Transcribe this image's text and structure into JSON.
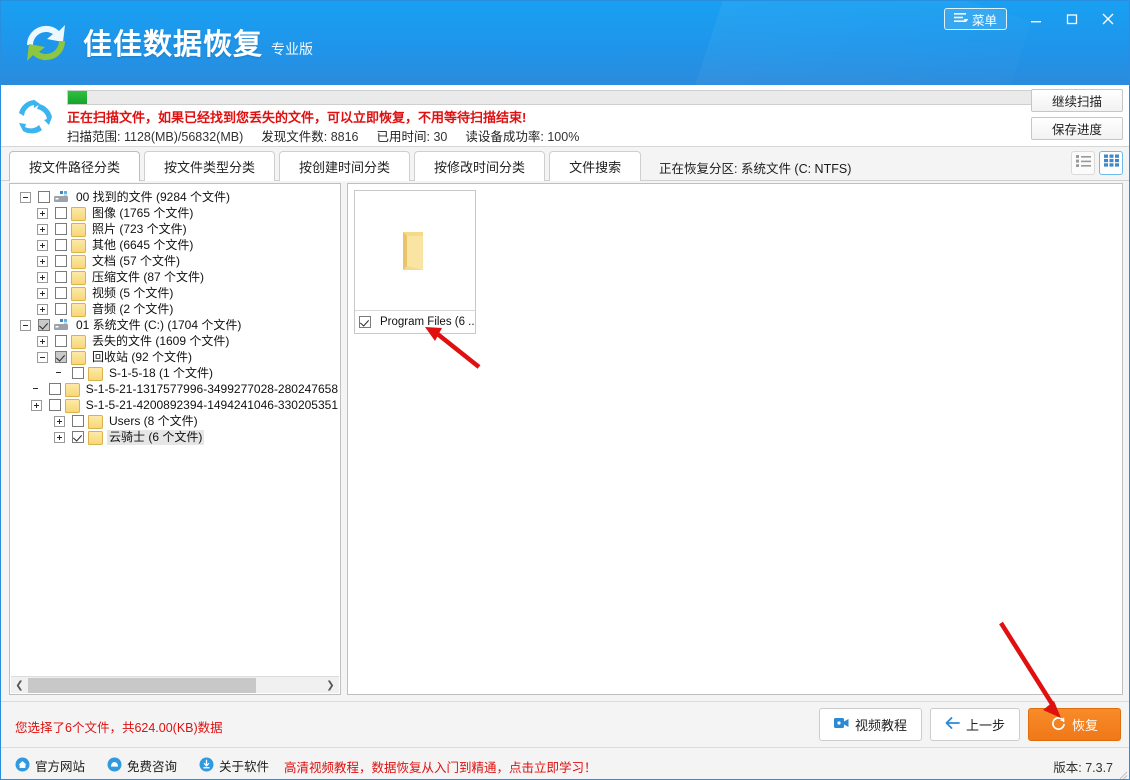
{
  "app": {
    "brand_main": "佳佳数据恢复",
    "brand_sub": "专业版",
    "menu_label": "菜单",
    "logo_icon": "recovery-arrows-logo"
  },
  "window_controls": {
    "minimize": "minimize-icon",
    "maximize": "maximize-icon",
    "close": "close-icon"
  },
  "scan": {
    "icon": "recycle-icon",
    "progress_percent": 2,
    "warning": "正在扫描文件，如果已经找到您丢失的文件，可以立即恢复，不用等待扫描结束!",
    "stats": [
      {
        "key": "扫描范围:",
        "value": "1128(MB)/56832(MB)"
      },
      {
        "key": "发现文件数:",
        "value": "8816"
      },
      {
        "key": "已用时间:",
        "value": "30"
      },
      {
        "key": "读设备成功率:",
        "value": "100%"
      }
    ],
    "buttons": [
      {
        "label": "继续扫描"
      },
      {
        "label": "保存进度"
      }
    ]
  },
  "tabs": {
    "items": [
      {
        "label": "按文件路径分类",
        "active": true
      },
      {
        "label": "按文件类型分类",
        "active": false
      },
      {
        "label": "按创建时间分类",
        "active": false
      },
      {
        "label": "按修改时间分类",
        "active": false
      },
      {
        "label": "文件搜索",
        "active": false
      }
    ],
    "partition_label": "正在恢复分区: 系统文件 (C: NTFS)",
    "view_list_icon": "list-view-icon",
    "view_grid_icon": "grid-view-icon",
    "active_view": "grid"
  },
  "tree": {
    "rows": [
      {
        "indent": 0,
        "expander": "minus",
        "check": "none",
        "icon": "drive",
        "label": "00 找到的文件",
        "count": "(9284 个文件)"
      },
      {
        "indent": 1,
        "expander": "plus",
        "check": "none",
        "icon": "folder",
        "label": "图像",
        "count": "(1765 个文件)"
      },
      {
        "indent": 1,
        "expander": "plus",
        "check": "none",
        "icon": "folder",
        "label": "照片",
        "count": "(723 个文件)"
      },
      {
        "indent": 1,
        "expander": "plus",
        "check": "none",
        "icon": "folder",
        "label": "其他",
        "count": "(6645 个文件)"
      },
      {
        "indent": 1,
        "expander": "plus",
        "check": "none",
        "icon": "folder",
        "label": "文档",
        "count": "(57 个文件)"
      },
      {
        "indent": 1,
        "expander": "plus",
        "check": "none",
        "icon": "folder",
        "label": "压缩文件",
        "count": "(87 个文件)"
      },
      {
        "indent": 1,
        "expander": "plus",
        "check": "none",
        "icon": "folder",
        "label": "视频",
        "count": "(5 个文件)"
      },
      {
        "indent": 1,
        "expander": "plus",
        "check": "none",
        "icon": "folder",
        "label": "音频",
        "count": "(2 个文件)"
      },
      {
        "indent": 0,
        "expander": "minus",
        "check": "partial",
        "icon": "drive",
        "label": "01 系统文件 (C:)",
        "count": "(1704 个文件)"
      },
      {
        "indent": 1,
        "expander": "plus",
        "check": "none",
        "icon": "folder",
        "label": "丢失的文件",
        "count": "(1609 个文件)"
      },
      {
        "indent": 1,
        "expander": "minus",
        "check": "partial",
        "icon": "folder",
        "label": "回收站",
        "count": "(92 个文件)"
      },
      {
        "indent": 2,
        "expander": "none",
        "check": "none",
        "icon": "folder",
        "label": "S-1-5-18",
        "count": "(1 个文件)"
      },
      {
        "indent": 2,
        "expander": "none",
        "check": "none",
        "icon": "folder",
        "label": "S-1-5-21-1317577996-3499277028-280247658",
        "count": ""
      },
      {
        "indent": 2,
        "expander": "plus",
        "check": "none",
        "icon": "folder",
        "label": "S-1-5-21-4200892394-1494241046-330205351",
        "count": ""
      },
      {
        "indent": 2,
        "expander": "plus",
        "check": "none",
        "icon": "folder",
        "label": "Users",
        "count": "(8 个文件)"
      },
      {
        "indent": 2,
        "expander": "plus",
        "check": "checked",
        "icon": "folder",
        "label": "云骑士",
        "count": "(6 个文件)",
        "selected": true
      }
    ]
  },
  "files": {
    "items": [
      {
        "name": "Program Files  (6 ...",
        "checked": true,
        "icon": "folder-icon"
      }
    ]
  },
  "selection": {
    "summary": "您选择了6个文件，共624.00(KB)数据"
  },
  "bottom_buttons": [
    {
      "label": "视频教程",
      "icon": "video-icon",
      "style": "normal"
    },
    {
      "label": "上一步",
      "icon": "arrow-left-icon",
      "style": "normal"
    },
    {
      "label": "恢复",
      "icon": "refresh-icon",
      "style": "primary"
    }
  ],
  "footer": {
    "links": [
      {
        "label": "官方网站",
        "icon": "home-icon"
      },
      {
        "label": "免费咨询",
        "icon": "chat-icon"
      },
      {
        "label": "关于软件",
        "icon": "info-icon"
      }
    ],
    "promo": "高清视频教程，数据恢复从入门到精通，点击立即学习！",
    "version": "版本: 7.3.7"
  },
  "colors": {
    "header_blue": "#1f95ea",
    "accent_orange": "#f07818",
    "warn_red": "#e01010",
    "progress_green": "#16a32a"
  }
}
